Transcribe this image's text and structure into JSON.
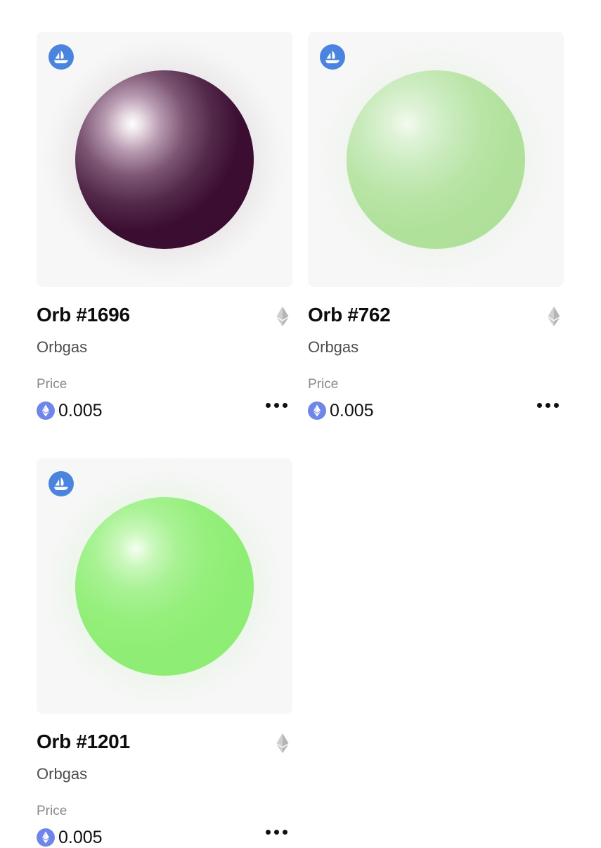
{
  "colors": {
    "badge": "#4a84df",
    "eth_price_icon": "#6f86e8",
    "chain_icon": "#b5b5b5",
    "title": "#0d0d0d",
    "collection": "#4d4d4d",
    "price_label": "#8a8a8a"
  },
  "cards": [
    {
      "title": "Orb #1696",
      "collection": "Orbgas",
      "price_label": "Price",
      "price": "0.005",
      "orb_color": "#3a0c30",
      "badge_icon": "opensea-ship-icon",
      "chain_icon": "ethereum-icon",
      "more_icon": "more-options-icon"
    },
    {
      "title": "Orb #762",
      "collection": "Orbgas",
      "price_label": "Price",
      "price": "0.005",
      "orb_color": "#aede99",
      "badge_icon": "opensea-ship-icon",
      "chain_icon": "ethereum-icon",
      "more_icon": "more-options-icon"
    },
    {
      "title": "Orb #1201",
      "collection": "Orbgas",
      "price_label": "Price",
      "price": "0.005",
      "orb_color": "#8dec72",
      "badge_icon": "opensea-ship-icon",
      "chain_icon": "ethereum-icon",
      "more_icon": "more-options-icon"
    }
  ]
}
